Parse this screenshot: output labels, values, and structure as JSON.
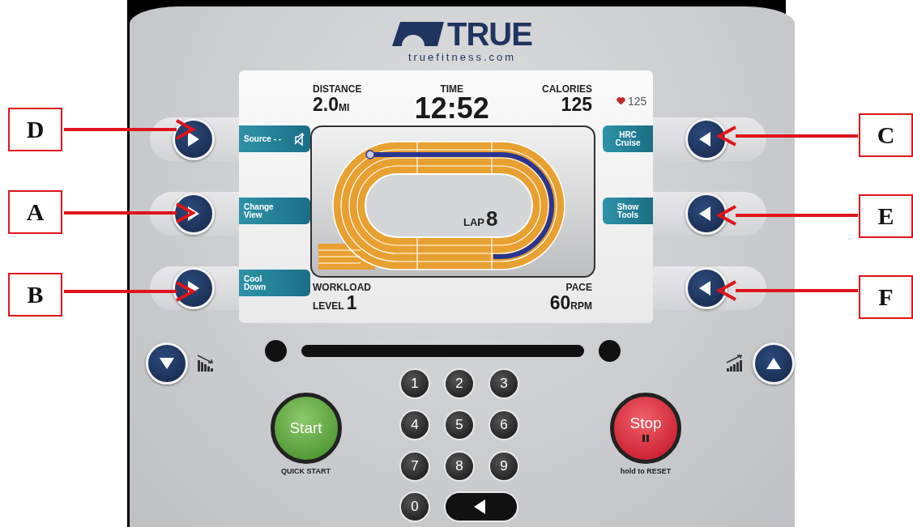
{
  "annotations": {
    "left": [
      "D",
      "A",
      "B"
    ],
    "right": [
      "C",
      "E",
      "F"
    ]
  },
  "logo": {
    "brand": "TRUE",
    "website": "truefitness.com"
  },
  "display": {
    "stats_top": [
      {
        "label": "DISTANCE",
        "value": "2.0",
        "unit": "MI"
      },
      {
        "label": "TIME",
        "value": "12:52"
      },
      {
        "label": "CALORIES",
        "value": "125"
      }
    ],
    "heart_rate": "125",
    "left_keys": [
      {
        "label": "Source",
        "sub": "- -"
      },
      {
        "label": "Change View"
      },
      {
        "label": "Cool Down"
      }
    ],
    "right_keys": [
      {
        "label": "HRC Cruise"
      },
      {
        "label": "Show Tools"
      }
    ],
    "lap": {
      "label": "LAP",
      "value": "8"
    },
    "stats_bottom": [
      {
        "label": "WORKLOAD",
        "prefix": "LEVEL",
        "value": "1"
      },
      {
        "label": "PACE",
        "value": "60",
        "unit": "RPM"
      }
    ]
  },
  "keypad": [
    "1",
    "2",
    "3",
    "4",
    "5",
    "6",
    "7",
    "8",
    "9",
    "0"
  ],
  "start": {
    "label": "Start",
    "caption": "QUICK START"
  },
  "stop": {
    "label": "Stop",
    "caption": "hold to RESET"
  }
}
